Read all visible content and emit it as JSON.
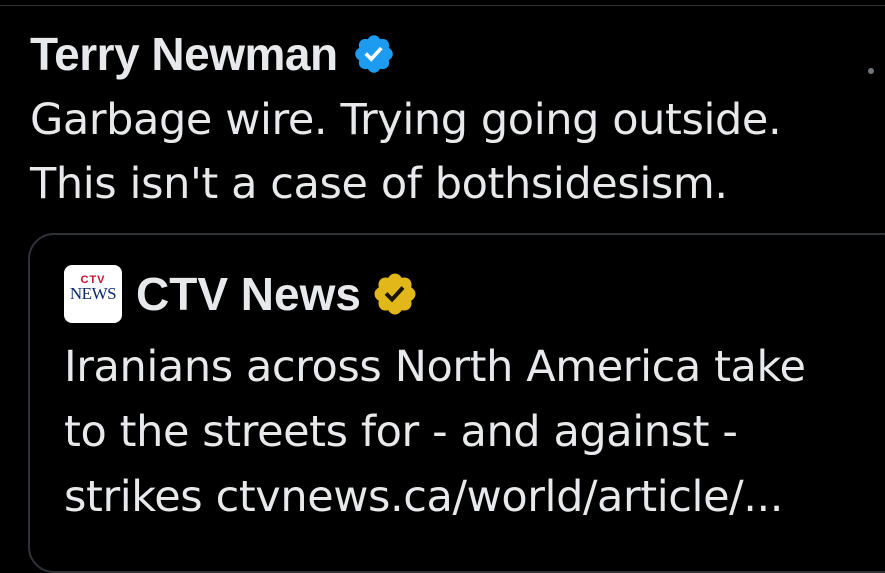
{
  "tweet": {
    "author_name": "Terry Newman",
    "verified_icon": "blue-verified-badge-icon",
    "text": "Garbage wire. Trying going outside.\nThis isn't a case of bothsidesism."
  },
  "quote": {
    "author_name": "CTV News",
    "logo": {
      "top": "CTV",
      "bottom": "NEWS"
    },
    "verified_icon": "gold-verified-badge-icon",
    "text": "Iranians across North America take\nto the streets for - and against -\nstrikes ",
    "link_text": "ctvnews.ca/world/article/..."
  },
  "colors": {
    "background": "#000000",
    "text": "#e7e9ea",
    "border": "#2f3336",
    "blue_badge": "#1d9bf0",
    "gold_badge": "#e2b719"
  }
}
